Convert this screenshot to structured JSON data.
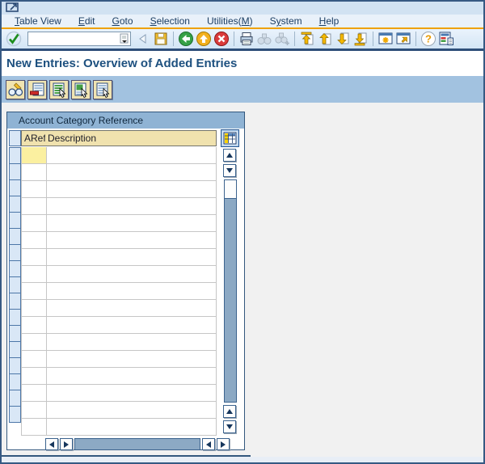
{
  "window": {
    "system_menu_icon": "sap-window-arrow-icon"
  },
  "menu_bar": {
    "items": [
      {
        "label": "Table View",
        "mnemonic": 0
      },
      {
        "label": "Edit",
        "mnemonic": 0
      },
      {
        "label": "Goto",
        "mnemonic": 0
      },
      {
        "label": "Selection",
        "mnemonic": 0
      },
      {
        "label": "Utilities(M)",
        "mnemonic": 10
      },
      {
        "label": "System",
        "mnemonic": 1
      },
      {
        "label": "Help",
        "mnemonic": 0
      }
    ]
  },
  "toolbar": {
    "command_field": {
      "value": "",
      "placeholder": ""
    },
    "buttons": [
      {
        "name": "enter",
        "icon": "green-check-icon",
        "disabled": false
      },
      {
        "name": "command-field-collapse",
        "icon": "left-triangle-icon",
        "disabled": false
      },
      {
        "name": "save",
        "icon": "floppy-disk-icon",
        "disabled": false
      },
      {
        "name": "back",
        "icon": "green-circle-left-arrow-icon",
        "disabled": false
      },
      {
        "name": "exit",
        "icon": "yellow-circle-up-arrow-icon",
        "disabled": false
      },
      {
        "name": "cancel",
        "icon": "red-circle-x-icon",
        "disabled": false
      },
      {
        "name": "print",
        "icon": "printer-icon",
        "disabled": false
      },
      {
        "name": "find",
        "icon": "binoculars-icon",
        "disabled": true
      },
      {
        "name": "find-next",
        "icon": "binoculars-plus-icon",
        "disabled": true
      },
      {
        "name": "first-page",
        "icon": "page-first-icon",
        "disabled": false
      },
      {
        "name": "page-up",
        "icon": "page-up-icon",
        "disabled": false
      },
      {
        "name": "page-down",
        "icon": "page-down-icon",
        "disabled": false
      },
      {
        "name": "last-page",
        "icon": "page-last-icon",
        "disabled": false
      },
      {
        "name": "new-session",
        "icon": "window-star-icon",
        "disabled": false
      },
      {
        "name": "create-shortcut",
        "icon": "window-shortcut-icon",
        "disabled": false
      },
      {
        "name": "help",
        "icon": "question-mark-icon",
        "disabled": false
      },
      {
        "name": "customize-layout",
        "icon": "layout-colors-icon",
        "disabled": false
      }
    ]
  },
  "title_bar": {
    "title": "New Entries: Overview of Added Entries"
  },
  "app_toolbar": {
    "buttons": [
      {
        "name": "change-display-toggle",
        "icon": "glasses-pencil-icon"
      },
      {
        "name": "delete-row",
        "icon": "table-red-minus-icon"
      },
      {
        "name": "select-all",
        "icon": "table-select-all-icon"
      },
      {
        "name": "select-block",
        "icon": "table-select-block-icon"
      },
      {
        "name": "deselect-all",
        "icon": "table-deselect-icon"
      }
    ]
  },
  "table_panel": {
    "title": "Account Category Reference",
    "columns": [
      {
        "label": "ARef"
      },
      {
        "label": "Description"
      }
    ],
    "rows": [],
    "visible_row_count": 17,
    "focused_cell": {
      "row": 1,
      "column": "ARef"
    },
    "config_button_icon": "table-configuration-icon"
  },
  "colors": {
    "window_border": "#365983",
    "menu_strip": "#d1e2f2",
    "orange_rule": "#efa100",
    "toolbar_bg": "#dcebf7",
    "title_text": "#1d507f",
    "app_toolbar_bg": "#a2c2e0",
    "panel_header_bg": "#8fb3d4",
    "column_header_bg": "#f0e2ae",
    "focused_cell_bg": "#fbf0a0",
    "row_selector_bg": "#d9e7f6",
    "scroll_track": "#8ca9c4",
    "content_bg": "#f1f1f1"
  }
}
